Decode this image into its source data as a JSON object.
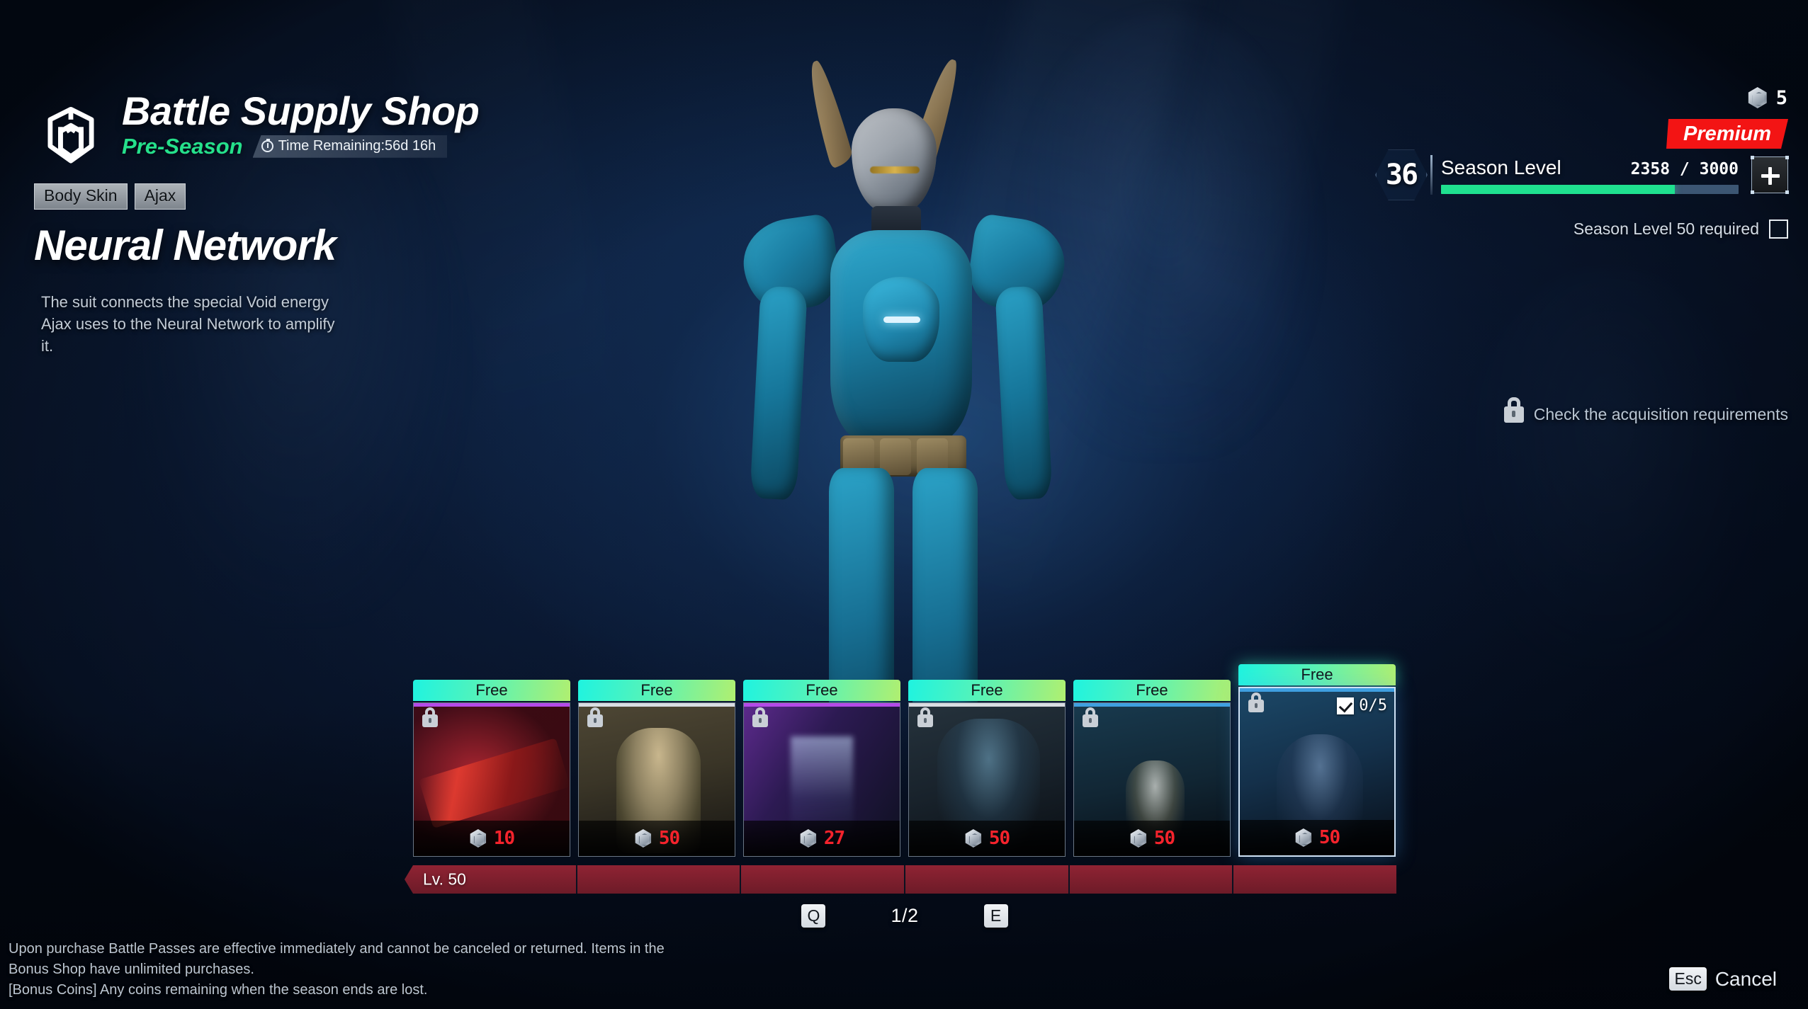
{
  "header": {
    "logo_icon": "hex-cube-logo-icon",
    "shop_title": "Battle Supply Shop",
    "season_label": "Pre-Season",
    "clock_icon": "stopwatch-icon",
    "time_remaining": "Time Remaining:56d 16h"
  },
  "item": {
    "tags": [
      "Body Skin",
      "Ajax"
    ],
    "name": "Neural Network",
    "description": "The suit connects the special Void energy Ajax uses to the Neural Network to amplify it."
  },
  "currency": {
    "coin_icon": "hex-coin-icon",
    "amount": "5"
  },
  "premium": {
    "label": "Premium",
    "color": "#f31414"
  },
  "season": {
    "level_badge": "36",
    "label": "Season Level",
    "progress_text": "2358 / 3000",
    "progress_current": 2358,
    "progress_max": 3000,
    "progress_percent": 78.6,
    "bar_color": "#1fe08f",
    "add_button_icon": "plus-icon",
    "requirement_text": "Season Level 50 required",
    "requirement_checked": false
  },
  "acquisition": {
    "lock_icon": "lock-icon",
    "text": "Check the acquisition requirements"
  },
  "cards": [
    {
      "ribbon": "Free",
      "price": "10",
      "locked": true,
      "lock_icon": "lock-icon",
      "coin_icon": "hex-coin-icon",
      "art": "art-a",
      "rarity_color": "#b44ae8",
      "selected": false
    },
    {
      "ribbon": "Free",
      "price": "50",
      "locked": true,
      "lock_icon": "lock-icon",
      "coin_icon": "hex-coin-icon",
      "art": "art-b",
      "rarity_color": "#d9dde2",
      "selected": false
    },
    {
      "ribbon": "Free",
      "price": "27",
      "locked": true,
      "lock_icon": "lock-icon",
      "coin_icon": "hex-coin-icon",
      "art": "art-c",
      "rarity_color": "#b44ae8",
      "selected": false
    },
    {
      "ribbon": "Free",
      "price": "50",
      "locked": true,
      "lock_icon": "lock-icon",
      "coin_icon": "hex-coin-icon",
      "art": "art-d",
      "rarity_color": "#d9dde2",
      "selected": false
    },
    {
      "ribbon": "Free",
      "price": "50",
      "locked": true,
      "lock_icon": "lock-icon",
      "coin_icon": "hex-coin-icon",
      "art": "art-e",
      "rarity_color": "#3f9fe0",
      "selected": false
    },
    {
      "ribbon": "Free",
      "price": "50",
      "locked": true,
      "lock_icon": "lock-icon",
      "coin_icon": "hex-coin-icon",
      "art": "art-f",
      "rarity_color": "#3f9fe0",
      "selected": true,
      "check_count": "0/5",
      "check_icon": "checkbox-checked-icon"
    }
  ],
  "level_bar": {
    "label": "Lv. 50",
    "color": "#8f2333",
    "segments": 6
  },
  "pager": {
    "prev_key": "Q",
    "next_key": "E",
    "page_text": "1/2"
  },
  "footer": {
    "disclaimer_line1": "Upon purchase Battle Passes are effective immediately and cannot be canceled or returned. Items in the",
    "disclaimer_line2": "Bonus Shop have unlimited purchases.",
    "disclaimer_line3": "[Bonus Coins] Any coins remaining when the season ends are lost.",
    "cancel_key": "Esc",
    "cancel_label": "Cancel"
  }
}
